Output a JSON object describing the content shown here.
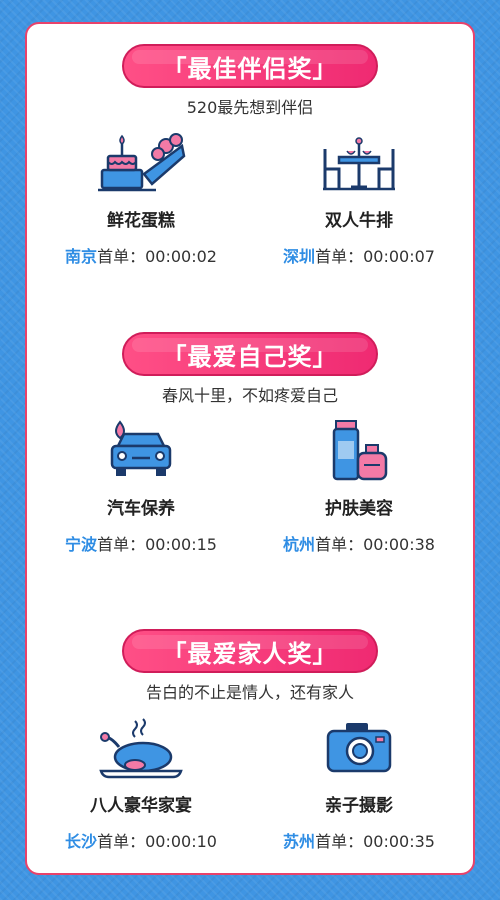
{
  "colors": {
    "background": "#3f95e3",
    "banner": "#ef2a72",
    "city": "#2f8de4",
    "icon_navy": "#1b3a6b",
    "icon_blue": "#3f95e3",
    "icon_pink": "#f37aa6"
  },
  "sections": [
    {
      "title": "「最佳伴侣奖」",
      "subtitle": "520最先想到伴侣",
      "items": [
        {
          "icon": "cake-flowers-icon",
          "name": "鲜花蛋糕",
          "city": "南京",
          "label": "首单：",
          "time": "00:00:02"
        },
        {
          "icon": "dinner-table-icon",
          "name": "双人牛排",
          "city": "深圳",
          "label": "首单：",
          "time": "00:00:07"
        }
      ]
    },
    {
      "title": "「最爱自己奖」",
      "subtitle": "春风十里，不如疼爱自己",
      "items": [
        {
          "icon": "car-wash-icon",
          "name": "汽车保养",
          "city": "宁波",
          "label": "首单：",
          "time": "00:00:15"
        },
        {
          "icon": "skincare-icon",
          "name": "护肤美容",
          "city": "杭州",
          "label": "首单：",
          "time": "00:00:38"
        }
      ]
    },
    {
      "title": "「最爱家人奖」",
      "subtitle": "告白的不止是情人，还有家人",
      "items": [
        {
          "icon": "roast-chicken-icon",
          "name": "八人豪华家宴",
          "city": "长沙",
          "label": "首单：",
          "time": "00:00:10"
        },
        {
          "icon": "camera-icon",
          "name": "亲子摄影",
          "city": "苏州",
          "label": "首单：",
          "time": "00:00:35"
        }
      ]
    }
  ]
}
